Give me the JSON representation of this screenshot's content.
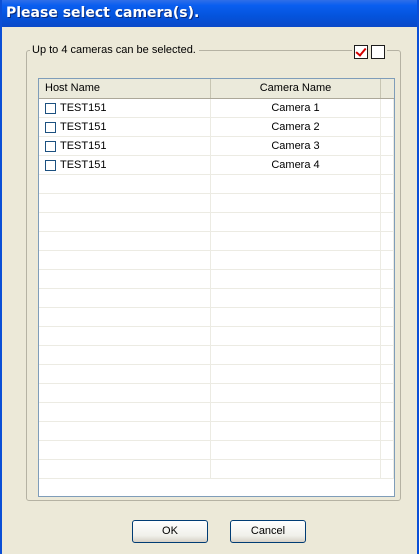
{
  "window": {
    "title": "Please select camera(s)."
  },
  "group": {
    "legend": "Up to 4 cameras can be selected."
  },
  "toolbar": {
    "check_all_icon": "check-all-icon",
    "clear_all_icon": "uncheck-all-icon"
  },
  "list": {
    "columns": [
      "Host Name",
      "Camera Name"
    ],
    "rows": [
      {
        "host": "TEST151",
        "camera": "Camera 1",
        "checked": false
      },
      {
        "host": "TEST151",
        "camera": "Camera 2",
        "checked": false
      },
      {
        "host": "TEST151",
        "camera": "Camera 3",
        "checked": false
      },
      {
        "host": "TEST151",
        "camera": "Camera 4",
        "checked": false
      }
    ]
  },
  "buttons": {
    "ok": "OK",
    "cancel": "Cancel"
  },
  "colors": {
    "title_bar": "#0453dc",
    "dialog_bg": "#ece9d8",
    "check_mark": "#d40000"
  }
}
